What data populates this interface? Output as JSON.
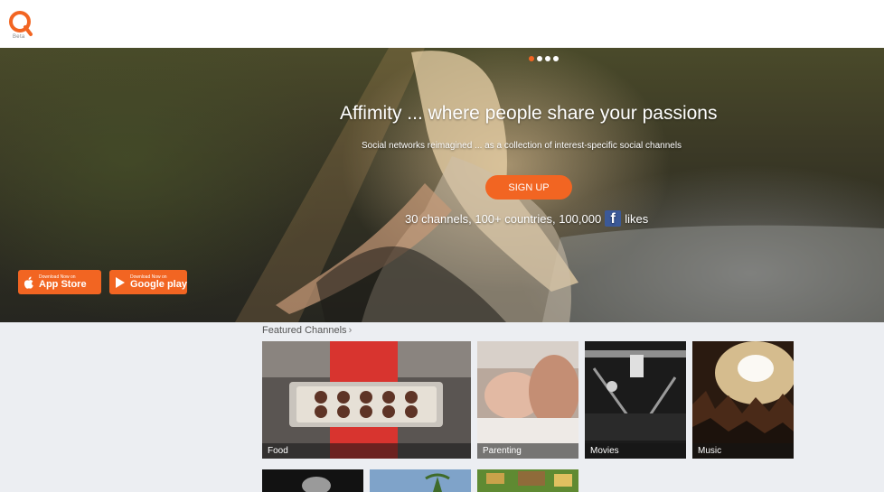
{
  "header": {
    "logo_icon": "affimity-logo-icon",
    "logo_subtext": "Beta"
  },
  "hero": {
    "carousel_dots": [
      true,
      false,
      false,
      false
    ],
    "title": "Affimity ... where people share your passions",
    "subtitle": "Social networks reimagined ... as a collection of interest-specific social channels",
    "signup_label": "SIGN UP",
    "stats_before": "30 channels, 100+ countries, 100,000",
    "stats_after": "likes",
    "app_store": {
      "small": "Download Now on",
      "big": "App Store"
    },
    "google_play": {
      "small": "Download Now on",
      "big": "Google play"
    }
  },
  "featured": {
    "label": "Featured Channels",
    "channels": [
      {
        "name": "Food"
      },
      {
        "name": "Parenting"
      },
      {
        "name": "Movies"
      },
      {
        "name": "Music"
      }
    ]
  },
  "colors": {
    "accent": "#f26522",
    "facebook": "#3b5998",
    "page_bg": "#eceef2"
  }
}
